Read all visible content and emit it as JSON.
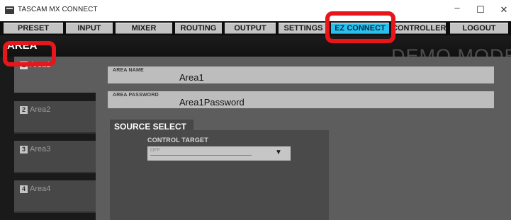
{
  "window": {
    "title": "TASCAM MX CONNECT",
    "minimize": "–",
    "maximize": "☐",
    "close": "✕"
  },
  "nav": {
    "items": [
      {
        "label": "PRESET"
      },
      {
        "label": "INPUT"
      },
      {
        "label": "MIXER"
      },
      {
        "label": "ROUTING"
      },
      {
        "label": "OUTPUT"
      },
      {
        "label": "SETTINGS"
      },
      {
        "label": "EZ CONNECT",
        "active": true
      },
      {
        "label": "CONTROLLER"
      },
      {
        "label": "LOGOUT"
      }
    ]
  },
  "page": {
    "title": "AREA",
    "watermark": "DEMO MODE"
  },
  "areas": [
    {
      "number": "1",
      "label": "Area1",
      "selected": true
    },
    {
      "number": "2",
      "label": "Area2",
      "selected": false
    },
    {
      "number": "3",
      "label": "Area3",
      "selected": false
    },
    {
      "number": "4",
      "label": "Area4",
      "selected": false
    }
  ],
  "form": {
    "area_name_label": "AREA NAME",
    "area_name_value": "Area1",
    "area_password_label": "AREA PASSWORD",
    "area_password_value": "Area1Password"
  },
  "source_select": {
    "title": "SOURCE SELECT",
    "control_target_label": "CONTROL TARGET",
    "control_target_value": "OFF",
    "dropdown_arrow": "▼"
  },
  "colors": {
    "accent": "#29c0ef",
    "highlight": "#e8151a"
  }
}
